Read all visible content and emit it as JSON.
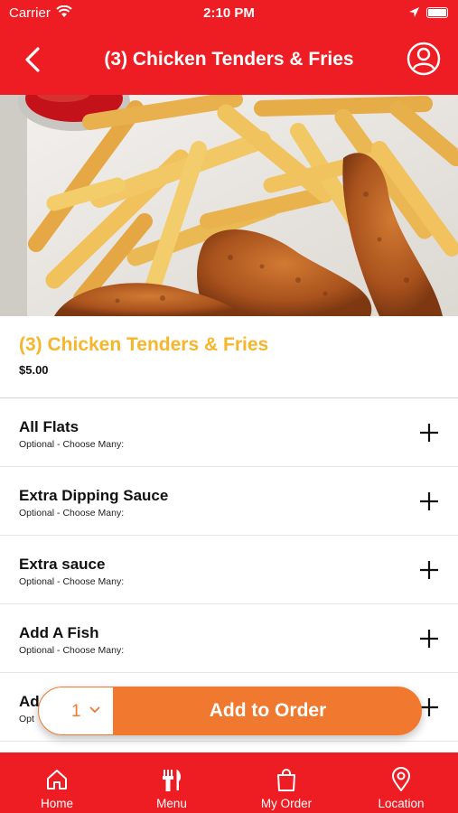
{
  "status_bar": {
    "carrier": "Carrier",
    "time": "2:10 PM"
  },
  "header": {
    "title": "(3) Chicken Tenders & Fries",
    "back_icon": "chevron-left-icon",
    "profile_icon": "user-circle-icon"
  },
  "item": {
    "name": "(3) Chicken Tenders & Fries",
    "price": "$5.00",
    "image": "chicken tenders and french fries with ketchup"
  },
  "options": [
    {
      "name": "All Flats",
      "subtitle": "Optional - Choose Many:"
    },
    {
      "name": "Extra Dipping Sauce",
      "subtitle": "Optional - Choose Many:"
    },
    {
      "name": "Extra sauce",
      "subtitle": "Optional - Choose Many:"
    },
    {
      "name": "Add A Fish",
      "subtitle": "Optional - Choose Many:"
    },
    {
      "name": "Ad",
      "subtitle": "Opt"
    }
  ],
  "order": {
    "quantity": "1",
    "add_label": "Add to Order"
  },
  "tabs": [
    {
      "label": "Home",
      "icon": "home-icon"
    },
    {
      "label": "Menu",
      "icon": "fork-knife-icon"
    },
    {
      "label": "My Order",
      "icon": "shopping-bag-icon"
    },
    {
      "label": "Location",
      "icon": "location-pin-icon"
    }
  ],
  "colors": {
    "brand_red": "#ee1d23",
    "accent_orange": "#f0782f",
    "title_yellow": "#f7b52c"
  }
}
